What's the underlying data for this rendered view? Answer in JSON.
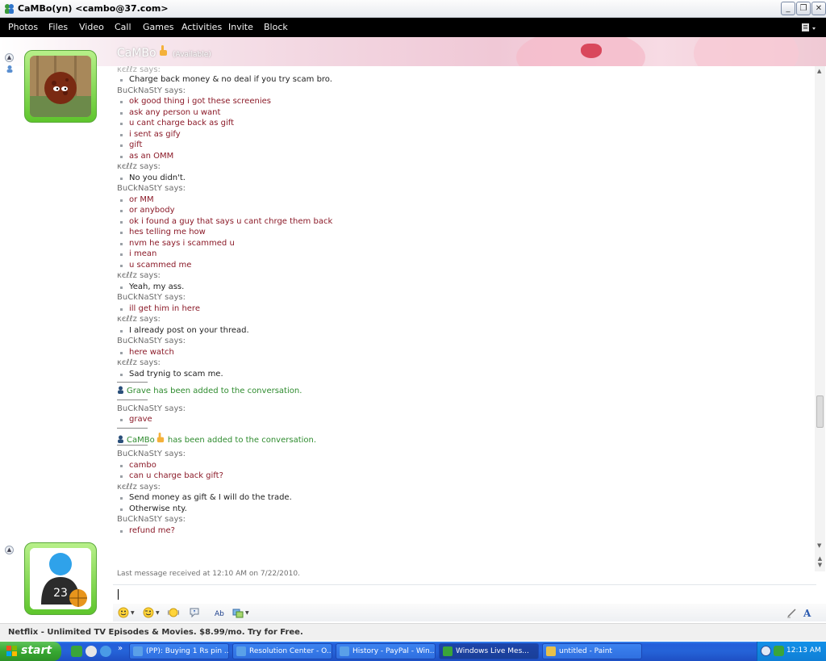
{
  "window": {
    "title": "CaMBo(yn) <cambo@37.com>",
    "buttons": {
      "minimize": "_",
      "restore": "❐",
      "close": "✕"
    }
  },
  "menu": [
    "Photos",
    "Files",
    "Video",
    "Call",
    "Games",
    "Activities",
    "Invite",
    "Block"
  ],
  "contact": {
    "name": "CaMBo",
    "status": "(Available)"
  },
  "messages": [
    {
      "kind": "msg",
      "text": "Charge back money & no deal if you try scam bro.",
      "color": "dark"
    },
    {
      "kind": "sender",
      "text": "BuCkNaStY says:"
    },
    {
      "kind": "msg",
      "text": "ok good thing i got these screenies",
      "color": "red"
    },
    {
      "kind": "msg",
      "text": "ask any person u want",
      "color": "red"
    },
    {
      "kind": "msg",
      "text": "u cant charge back as gift",
      "color": "red"
    },
    {
      "kind": "msg",
      "text": "i sent as gify",
      "color": "red"
    },
    {
      "kind": "msg",
      "text": "gift",
      "color": "red"
    },
    {
      "kind": "msg",
      "text": "as an OMM",
      "color": "red"
    },
    {
      "kind": "sender",
      "text": "κєℓℓz says:"
    },
    {
      "kind": "msg",
      "text": "No you didn't.",
      "color": "dark"
    },
    {
      "kind": "sender",
      "text": "BuCkNaStY says:"
    },
    {
      "kind": "msg",
      "text": "or MM",
      "color": "red"
    },
    {
      "kind": "msg",
      "text": "or anybody",
      "color": "red"
    },
    {
      "kind": "msg",
      "text": "ok i found a guy that says u cant chrge them back",
      "color": "red"
    },
    {
      "kind": "msg",
      "text": "hes telling me how",
      "color": "red"
    },
    {
      "kind": "msg",
      "text": "nvm he says i scammed u",
      "color": "red"
    },
    {
      "kind": "msg",
      "text": "i mean",
      "color": "red"
    },
    {
      "kind": "msg",
      "text": "u scammed me",
      "color": "red"
    },
    {
      "kind": "sender",
      "text": "κєℓℓz says:"
    },
    {
      "kind": "msg",
      "text": "Yeah, my ass.",
      "color": "dark"
    },
    {
      "kind": "sender",
      "text": "BuCkNaStY says:"
    },
    {
      "kind": "msg",
      "text": "ill get him in here",
      "color": "red"
    },
    {
      "kind": "sender",
      "text": "κєℓℓz says:"
    },
    {
      "kind": "msg",
      "text": "I already post on your thread.",
      "color": "dark"
    },
    {
      "kind": "sender",
      "text": "BuCkNaStY says:"
    },
    {
      "kind": "msg",
      "text": "here watch",
      "color": "red"
    },
    {
      "kind": "sender",
      "text": "κєℓℓz says:"
    },
    {
      "kind": "msg",
      "text": "Sad trynig to scam me.",
      "color": "dark"
    },
    {
      "kind": "sep"
    },
    {
      "kind": "system",
      "text": "Grave has been added to the conversation."
    },
    {
      "kind": "sep"
    },
    {
      "kind": "sender",
      "text": "BuCkNaStY says:"
    },
    {
      "kind": "msg",
      "text": "grave",
      "color": "red"
    },
    {
      "kind": "sep"
    },
    {
      "kind": "system",
      "text": "CaMBo",
      "suffix": " has been added to the conversation."
    },
    {
      "kind": "sep"
    },
    {
      "kind": "sender",
      "text": "BuCkNaStY says:"
    },
    {
      "kind": "msg",
      "text": "cambo",
      "color": "red"
    },
    {
      "kind": "msg",
      "text": "can u charge back gift?",
      "color": "red"
    },
    {
      "kind": "sender",
      "text": "κєℓℓz says:"
    },
    {
      "kind": "msg",
      "text": "Send money as gift & I will do the trade.",
      "color": "dark"
    },
    {
      "kind": "msg",
      "text": "Otherwise nty.",
      "color": "dark"
    },
    {
      "kind": "sender",
      "text": "BuCkNaStY says:"
    },
    {
      "kind": "msg",
      "text": "refund me?",
      "color": "red"
    }
  ],
  "last_message": "Last message received at 12:10 AM on 7/22/2010.",
  "ad": "Netflix - Unlimited TV Episodes & Movies. $8.99/mo. Try for Free.",
  "taskbar": {
    "start": "start",
    "tasks": [
      "(PP): Buying 1 Rs pin ...",
      "Resolution Center - O...",
      "History - PayPal - Win...",
      "Windows Live Mes...",
      "untitled - Paint"
    ],
    "clock": "12:13 AM"
  },
  "colors": {
    "menubar": "#000000",
    "red_text": "#8b1a28",
    "system_text": "#2e8b2e",
    "taskbar": "#245edb"
  }
}
